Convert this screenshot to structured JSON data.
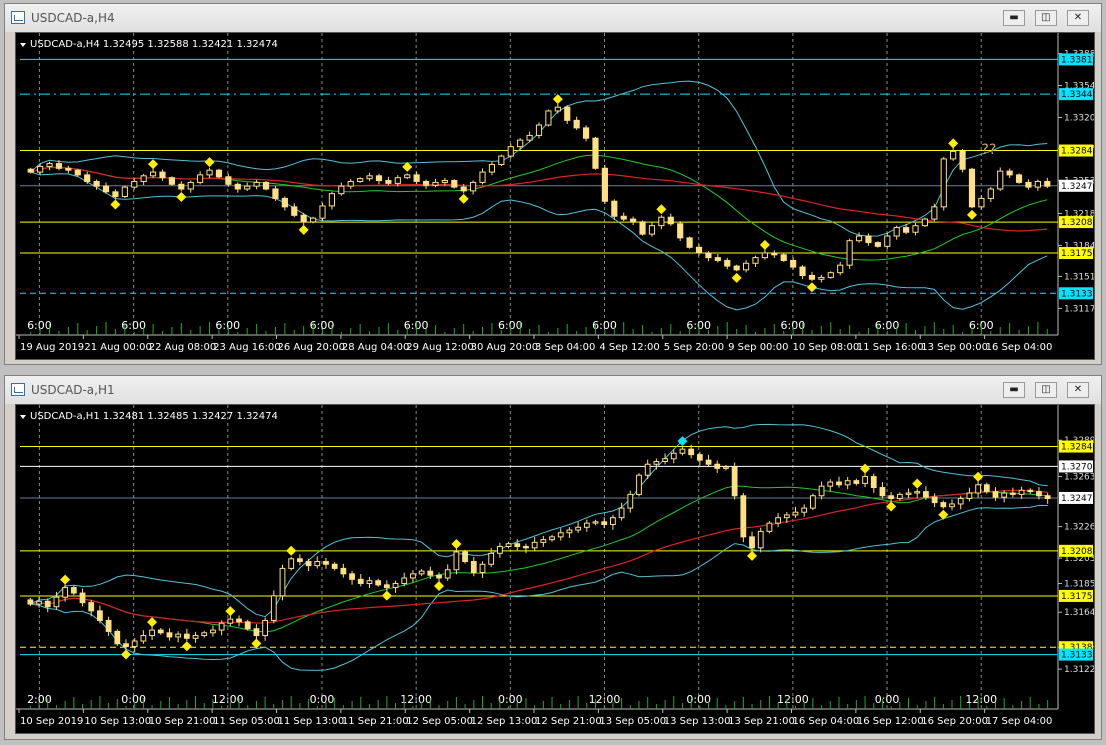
{
  "windows": [
    {
      "title": "USDCAD-a,H4",
      "buttons": {
        "minimize": "▬",
        "restore": "◫",
        "close": "✕"
      },
      "chart_data": {
        "type": "candlestick",
        "symbol": "USDCAD-a,H4",
        "ohlc_text": "1.32495 1.32588 1.32421 1.32474",
        "ylim": [
          1.311,
          1.3395
        ],
        "y_ticks": [
          "1.33880",
          "1.33540",
          "1.33200",
          "1.32870",
          "1.32530",
          "1.32180",
          "1.31840",
          "1.31510",
          "1.31170"
        ],
        "price_lines": [
          {
            "value": 1.33818,
            "label": "1.33818",
            "color": "#00e5ff",
            "style": "solid"
          },
          {
            "value": 1.33449,
            "label": "1.33449",
            "color": "#00e5ff",
            "style": "dashdot"
          },
          {
            "value": 1.32849,
            "label": "1.32849",
            "color": "#ffff00",
            "style": "solid"
          },
          {
            "value": 1.32474,
            "label": "1.32474",
            "color": "#ffffff",
            "style": "current"
          },
          {
            "value": 1.32088,
            "label": "1.32088",
            "color": "#ffff00",
            "style": "solid"
          },
          {
            "value": 1.31759,
            "label": "1.31759",
            "color": "#ffff00",
            "style": "solid"
          },
          {
            "value": 1.31331,
            "label": "1.31331",
            "color": "#00e5ff",
            "style": "dashed"
          }
        ],
        "x_labels": [
          "19 Aug 2019",
          "21 Aug 00:00",
          "22 Aug 08:00",
          "23 Aug 16:00",
          "26 Aug 20:00",
          "28 Aug 04:00",
          "29 Aug 12:00",
          "30 Aug 20:00",
          "3 Sep 04:00",
          "4 Sep 12:00",
          "5 Sep 20:00",
          "9 Sep 00:00",
          "10 Sep 08:00",
          "11 Sep 16:00",
          "13 Sep 00:00",
          "16 Sep 04:00"
        ],
        "session_labels": [
          "6:00",
          "6:00",
          "6:00",
          "6:00",
          "6:00",
          "6:00",
          "6:00",
          "6:00",
          "6:00",
          "6:00",
          "6:00"
        ],
        "annotation": "??",
        "close_series": [
          1.3262,
          1.3268,
          1.3271,
          1.3266,
          1.3264,
          1.3259,
          1.3252,
          1.3247,
          1.3241,
          1.3236,
          1.3246,
          1.3252,
          1.3258,
          1.3262,
          1.3256,
          1.3249,
          1.3244,
          1.3251,
          1.3259,
          1.3264,
          1.3257,
          1.3249,
          1.3244,
          1.3247,
          1.3251,
          1.3244,
          1.3234,
          1.3225,
          1.3216,
          1.3209,
          1.3213,
          1.3226,
          1.3239,
          1.3247,
          1.3252,
          1.3255,
          1.3258,
          1.3253,
          1.325,
          1.3256,
          1.3259,
          1.3252,
          1.3248,
          1.3251,
          1.3253,
          1.3246,
          1.3242,
          1.3251,
          1.3262,
          1.327,
          1.3279,
          1.3289,
          1.3296,
          1.3301,
          1.3312,
          1.3327,
          1.3331,
          1.3317,
          1.3309,
          1.3298,
          1.3266,
          1.3231,
          1.3215,
          1.3212,
          1.3209,
          1.3196,
          1.3205,
          1.3214,
          1.3207,
          1.3192,
          1.3182,
          1.3176,
          1.3171,
          1.3168,
          1.3162,
          1.3158,
          1.3165,
          1.3171,
          1.3176,
          1.3174,
          1.3168,
          1.3161,
          1.3152,
          1.3148,
          1.315,
          1.3155,
          1.3163,
          1.3189,
          1.3194,
          1.3187,
          1.3183,
          1.3194,
          1.3203,
          1.3198,
          1.3205,
          1.3212,
          1.3225,
          1.3276,
          1.3284,
          1.3265,
          1.3225,
          1.3234,
          1.3244,
          1.3263,
          1.3259,
          1.3251,
          1.3246,
          1.3252,
          1.3247
        ]
      }
    },
    {
      "title": "USDCAD-a,H1",
      "buttons": {
        "minimize": "▬",
        "restore": "◫",
        "close": "✕"
      },
      "chart_data": {
        "type": "candlestick",
        "symbol": "USDCAD-a,H1",
        "ohlc_text": "1.32481 1.32485 1.32427 1.32474",
        "ylim": [
          1.3108,
          1.3305
        ],
        "y_ticks": [
          "1.32895",
          "1.32630",
          "1.32265",
          "1.32035",
          "1.31850",
          "1.31640",
          "1.31385",
          "1.31225"
        ],
        "price_lines": [
          {
            "value": 1.32849,
            "label": "1.32849",
            "color": "#ffff00",
            "style": "solid"
          },
          {
            "value": 1.32704,
            "label": "1.32704",
            "color": "#ffffff",
            "style": "solid"
          },
          {
            "value": 1.32474,
            "label": "1.32474",
            "color": "#ffffff",
            "style": "current"
          },
          {
            "value": 1.32088,
            "label": "1.32088",
            "color": "#ffff00",
            "style": "solid"
          },
          {
            "value": 1.31759,
            "label": "1.31759",
            "color": "#ffff00",
            "style": "solid"
          },
          {
            "value": 1.31385,
            "label": "1.31385",
            "color": "#ffff00",
            "style": "dashed"
          },
          {
            "value": 1.31331,
            "label": "1.31331",
            "color": "#00e5ff",
            "style": "solid"
          }
        ],
        "x_labels": [
          "10 Sep 2019",
          "10 Sep 13:00",
          "10 Sep 21:00",
          "11 Sep 05:00",
          "11 Sep 13:00",
          "11 Sep 21:00",
          "12 Sep 05:00",
          "12 Sep 13:00",
          "12 Sep 21:00",
          "13 Sep 05:00",
          "13 Sep 13:00",
          "13 Sep 21:00",
          "16 Sep 04:00",
          "16 Sep 12:00",
          "16 Sep 20:00",
          "17 Sep 04:00"
        ],
        "session_labels": [
          "2:00",
          "0:00",
          "12:00",
          "0:00",
          "12:00",
          "0:00",
          "12:00",
          "0:00",
          "12:00",
          "0:00",
          "12:00"
        ],
        "close_series": [
          1.317,
          1.3172,
          1.3168,
          1.3175,
          1.3182,
          1.3178,
          1.3171,
          1.3165,
          1.3158,
          1.315,
          1.3141,
          1.3139,
          1.3143,
          1.3147,
          1.3151,
          1.3149,
          1.3146,
          1.3148,
          1.3145,
          1.3147,
          1.3149,
          1.3151,
          1.3156,
          1.3159,
          1.3157,
          1.3152,
          1.3147,
          1.3158,
          1.3176,
          1.3196,
          1.3203,
          1.3201,
          1.3198,
          1.3201,
          1.3199,
          1.3196,
          1.3192,
          1.3188,
          1.3185,
          1.3187,
          1.3184,
          1.3182,
          1.3185,
          1.3189,
          1.3192,
          1.3194,
          1.3191,
          1.3189,
          1.3195,
          1.3208,
          1.3201,
          1.3193,
          1.3199,
          1.3207,
          1.3212,
          1.3214,
          1.3212,
          1.3211,
          1.3215,
          1.3217,
          1.3219,
          1.3222,
          1.3224,
          1.3226,
          1.3229,
          1.323,
          1.3228,
          1.3233,
          1.324,
          1.325,
          1.3264,
          1.3272,
          1.3274,
          1.3276,
          1.328,
          1.3283,
          1.3279,
          1.3275,
          1.3272,
          1.3269,
          1.327,
          1.3249,
          1.3219,
          1.3211,
          1.3223,
          1.3229,
          1.3233,
          1.3235,
          1.3237,
          1.324,
          1.3249,
          1.3256,
          1.3259,
          1.3257,
          1.326,
          1.3258,
          1.3263,
          1.3255,
          1.3249,
          1.3247,
          1.325,
          1.3251,
          1.3252,
          1.3248,
          1.3244,
          1.3241,
          1.3243,
          1.3247,
          1.3251,
          1.3257,
          1.3252,
          1.3248,
          1.3251,
          1.325,
          1.3253,
          1.3252,
          1.3249,
          1.3247
        ]
      }
    }
  ]
}
